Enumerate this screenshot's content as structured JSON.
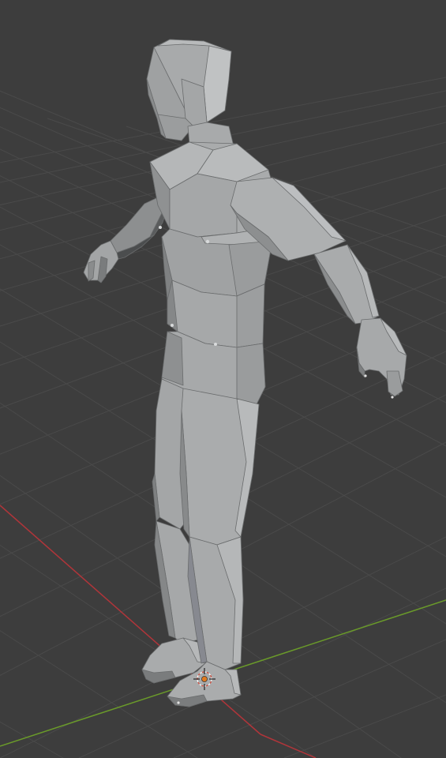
{
  "viewport": {
    "background": "#3d3d3d",
    "grid_color": "#4a4a4a",
    "x_axis_color": "#b0353a",
    "y_axis_color": "#6a9a2a"
  },
  "model": {
    "base_color": "#9a9c9d",
    "light_color": "#b2b4b5",
    "shadow_color": "#7c7e7f",
    "dark_color": "#5e6061",
    "edge_color": "#6a6c6d"
  },
  "origin_marker": {
    "color": "#e07a20"
  }
}
